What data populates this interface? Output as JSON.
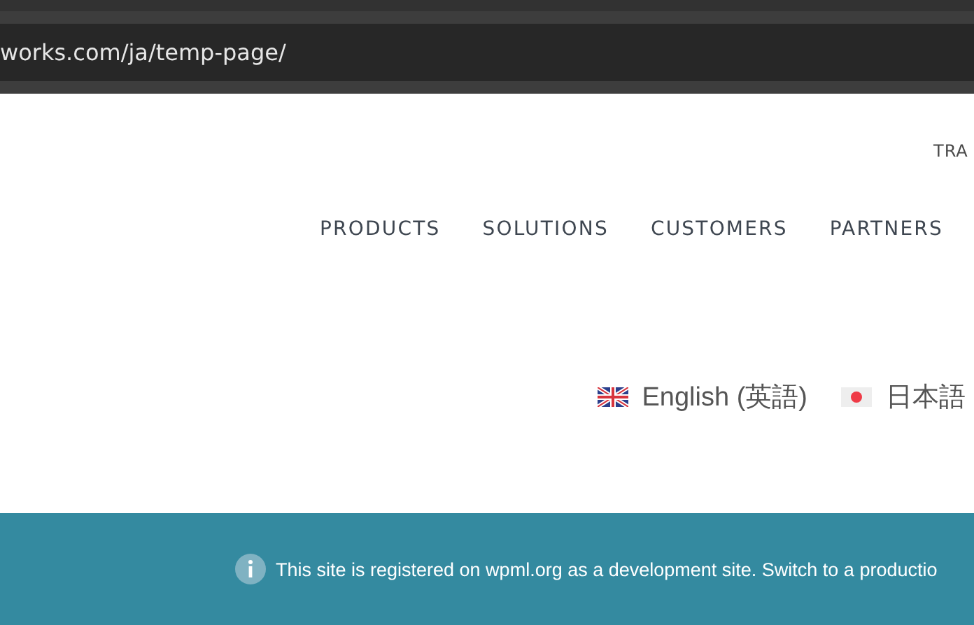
{
  "browser": {
    "url": "works.com/ja/temp-page/"
  },
  "top_link": "TRA",
  "nav": [
    "PRODUCTS",
    "SOLUTIONS",
    "CUSTOMERS",
    "PARTNERS"
  ],
  "languages": [
    {
      "label": "English (英語)",
      "kind": "uk"
    },
    {
      "label": "日本語",
      "kind": "jp"
    }
  ],
  "notice": {
    "text": "This site is registered on wpml.org as a development site. Switch to a productio"
  }
}
